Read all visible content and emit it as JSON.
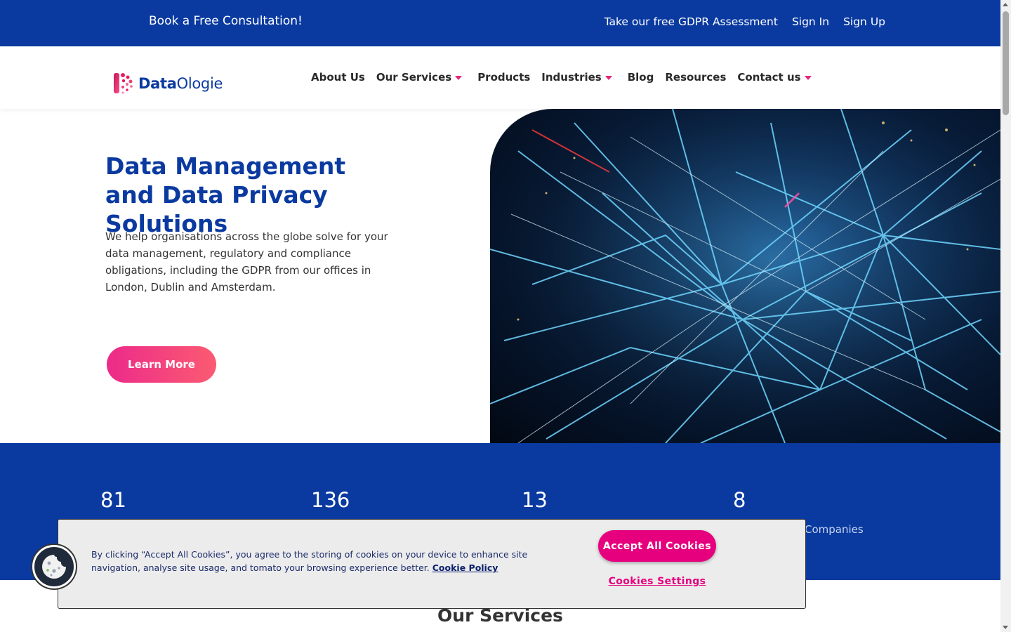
{
  "topbar": {
    "consult": "Book a Free Consultation!",
    "links": [
      "Take our free GDPR Assessment",
      "Sign In",
      "Sign Up"
    ]
  },
  "brand": {
    "name_bold": "Data",
    "name_light": "Ologie"
  },
  "nav": {
    "items": [
      "About Us",
      "Our Services",
      "Products",
      "Industries",
      "Blog",
      "Resources",
      "Contact us"
    ]
  },
  "hero": {
    "title": "Data Management and Data Privacy Solutions",
    "body": "We help organisations across the globe solve for your data management, regulatory and compliance obligations, including the GDPR from our offices in London, Dublin and Amsterdam.",
    "cta": "Learn More"
  },
  "stats": [
    {
      "value": "81",
      "label": ""
    },
    {
      "value": "136",
      "label": ""
    },
    {
      "value": "13",
      "label": ""
    },
    {
      "value": "8",
      "label": "Companies"
    }
  ],
  "sections": {
    "services_title": "Our Services"
  },
  "cookie": {
    "text": "By clicking “Accept All Cookies”, you agree to the storing of cookies on your device to enhance site navigation, analyse site usage, and tomato your browsing experience better.",
    "policy_link": "Cookie Policy",
    "accept": "Accept All Cookies",
    "settings": "Cookies Settings"
  },
  "colors": {
    "primary": "#0a3aa0",
    "accent": "#e6007e"
  }
}
